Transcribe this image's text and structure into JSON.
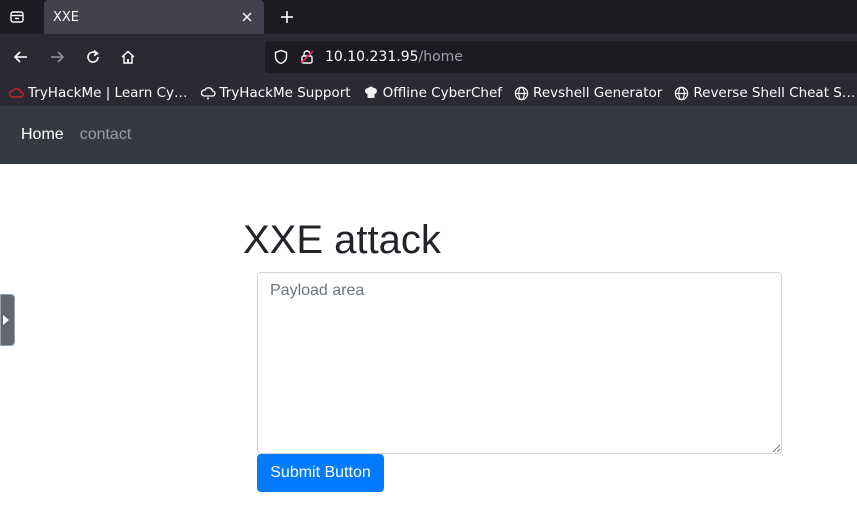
{
  "tab": {
    "title": "XXE"
  },
  "nav": {
    "url_host": "10.10.231.95",
    "url_path": "/home"
  },
  "bookmarks": [
    {
      "label": "TryHackMe | Learn Cy…",
      "icon": "tryhackme-cloud-icon"
    },
    {
      "label": "TryHackMe Support",
      "icon": "cloud-support-icon"
    },
    {
      "label": "Offline CyberChef",
      "icon": "chef-hat-icon"
    },
    {
      "label": "Revshell Generator",
      "icon": "globe-icon"
    },
    {
      "label": "Reverse Shell Cheat S…",
      "icon": "globe-icon"
    }
  ],
  "site_nav": {
    "home": "Home",
    "contact": "contact"
  },
  "main": {
    "heading": "XXE attack",
    "payload_placeholder": "Payload area",
    "submit_label": "Submit Button"
  },
  "colors": {
    "navbar_bg": "#343a40",
    "button_primary": "#007bff"
  }
}
